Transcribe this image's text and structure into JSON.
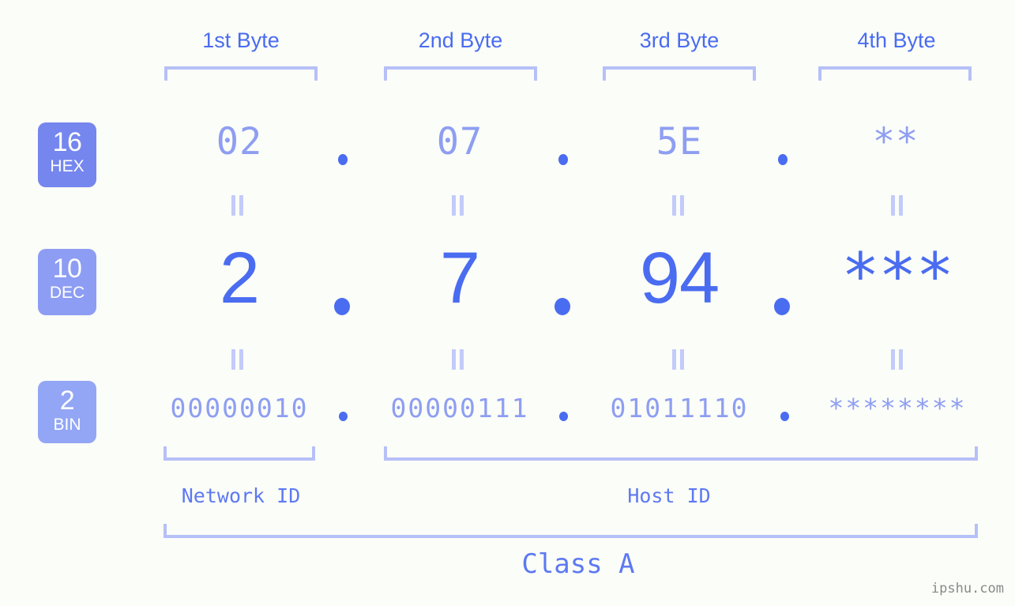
{
  "watermark": "ipshu.com",
  "byte_headers": [
    {
      "label": "1st Byte"
    },
    {
      "label": "2nd Byte"
    },
    {
      "label": "3rd Byte"
    },
    {
      "label": "4th Byte"
    }
  ],
  "bases": [
    {
      "num": "16",
      "abbr": "HEX",
      "color": "#7586ee"
    },
    {
      "num": "10",
      "abbr": "DEC",
      "color": "#8d9df3"
    },
    {
      "num": "2",
      "abbr": "BIN",
      "color": "#93a6f5"
    }
  ],
  "rows": {
    "hex": {
      "base": "16",
      "name": "HEX",
      "values": [
        "02",
        "07",
        "5E",
        "**"
      ]
    },
    "dec": {
      "base": "10",
      "name": "DEC",
      "values": [
        "2",
        "7",
        "94",
        "***"
      ]
    },
    "bin": {
      "base": "2",
      "name": "BIN",
      "values": [
        "00000010",
        "00000111",
        "01011110",
        "********"
      ]
    }
  },
  "separator": ".",
  "equal_mark": "=",
  "sections": [
    {
      "label": "Network ID"
    },
    {
      "label": "Host ID"
    }
  ],
  "class_label": "Class A",
  "colors": {
    "background": "#fbfdf8",
    "accent_strong": "#4a6cf0",
    "accent_light": "#8e9ef2",
    "bracket": "#b6c0f8",
    "equal_mark": "#c2cbfa",
    "watermark": "#8a8a8a"
  }
}
